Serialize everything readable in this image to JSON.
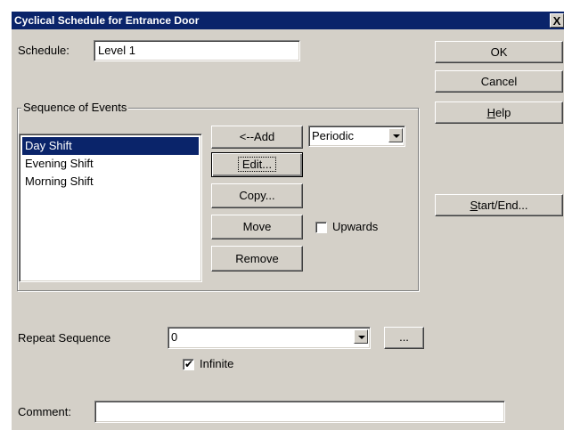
{
  "window": {
    "title": "Cyclical Schedule for Entrance Door",
    "close_label": "X"
  },
  "schedule": {
    "label": "Schedule:",
    "value": "Level 1"
  },
  "buttons": {
    "ok": "OK",
    "cancel": "Cancel",
    "help_mnemonic": "H",
    "help_rest": "elp",
    "start_end_mnemonic": "S",
    "start_end_rest": "tart/End..."
  },
  "sequence": {
    "group_label": "Sequence of Events",
    "events": [
      "Day Shift",
      "Evening Shift",
      "Morning Shift"
    ],
    "selected_index": 0,
    "add_label": "<--Add",
    "edit_label": "Edit...",
    "copy_label": "Copy...",
    "move_label": "Move",
    "remove_label": "Remove",
    "type_value": "Periodic",
    "upwards_label": "Upwards",
    "upwards_checked": false
  },
  "repeat": {
    "label": "Repeat Sequence",
    "value": "0",
    "browse_label": "...",
    "infinite_label": "Infinite",
    "infinite_checked": true
  },
  "comment": {
    "label": "Comment:",
    "value": ""
  }
}
